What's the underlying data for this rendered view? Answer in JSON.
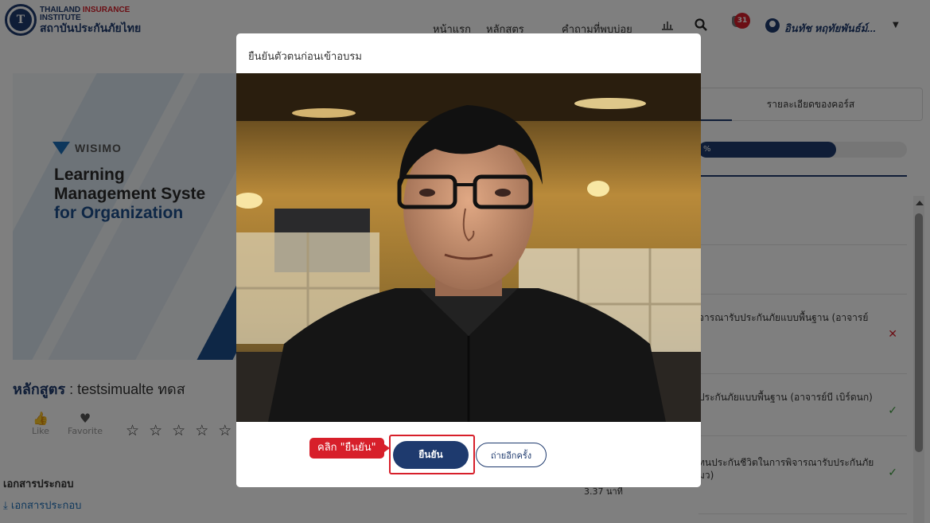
{
  "header": {
    "logo": {
      "line1_black": "THAILAND ",
      "line1_red": "INSURANCE",
      "line2": "INSTITUTE",
      "line3": "สถาบันประกันภัยไทย"
    },
    "nav": [
      "หน้าแรก",
      "หลักสูตร",
      "คำถามที่พบบ่อย"
    ],
    "notification_count": "31",
    "user_name": "อินทัช หฤทัยพันธ์ม์..."
  },
  "banner": {
    "brand": "WISIMO",
    "line1": "Learning",
    "line2": "Management Syste",
    "line3": "for Organization"
  },
  "course": {
    "label": "หลักสูตร",
    "separator": " : ",
    "name": "testsimualte ทดส"
  },
  "social": {
    "like": "Like",
    "favorite": "Favorite",
    "stars": "☆ ☆ ☆ ☆ ☆"
  },
  "documents": {
    "title": "เอกสารประกอบ",
    "link": "เอกสารประกอบ"
  },
  "right_panel": {
    "tab_label": "รายละเอียดของคอร์ส",
    "progress_text": "%",
    "progress_fraction": 0.66,
    "items": [
      {
        "text": "",
        "mark": ""
      },
      {
        "text": "",
        "mark": ""
      },
      {
        "text": "จารณารับประกันภัยแบบพื้นฐาน (อาจารย์",
        "mark": "✕"
      },
      {
        "text": "ประกันภัยแบบพื้นฐาน (อาจารย์บี เบิร์ดนก)",
        "mark": "✓"
      },
      {
        "text": "ทนประกันชีวิตในการพิจารณารับประกันภัย",
        "text2": "มว)",
        "mark": "✓"
      }
    ],
    "duration": "3.37 นาที"
  },
  "modal": {
    "title": "ยืนยันตัวตนก่อนเข้าอบรม",
    "hint": "คลิก \"ยืนยัน\"",
    "confirm_button": "ยืนยัน",
    "retake_button": "ถ่ายอีกครั้ง"
  },
  "colors": {
    "primary": "#1e3a6e",
    "accent_red": "#d71f2a",
    "success_green": "#3a9a3a",
    "link_blue": "#1d6fb8"
  }
}
